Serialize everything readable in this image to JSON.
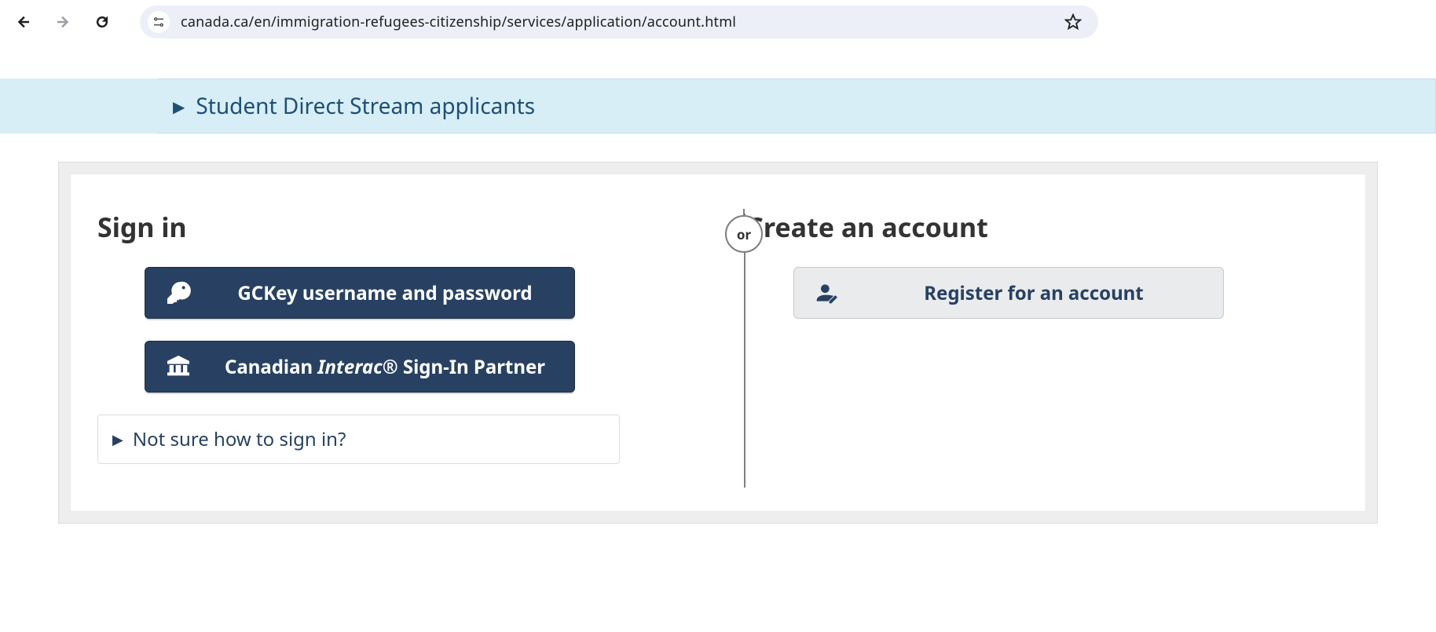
{
  "url": "canada.ca/en/immigration-refugees-citizenship/services/application/account.html",
  "banner": {
    "student_direct_stream_label": "Student Direct Stream applicants"
  },
  "signin": {
    "heading": "Sign in",
    "gckey_label": "GCKey username and password",
    "interac_prefix": "Canadian ",
    "interac_italic": "Interac",
    "interac_suffix": "® Sign-In Partner",
    "help_label": "Not sure how to sign in?"
  },
  "or_label": "or",
  "create": {
    "heading": "Create an account",
    "register_label": "Register for an account"
  }
}
